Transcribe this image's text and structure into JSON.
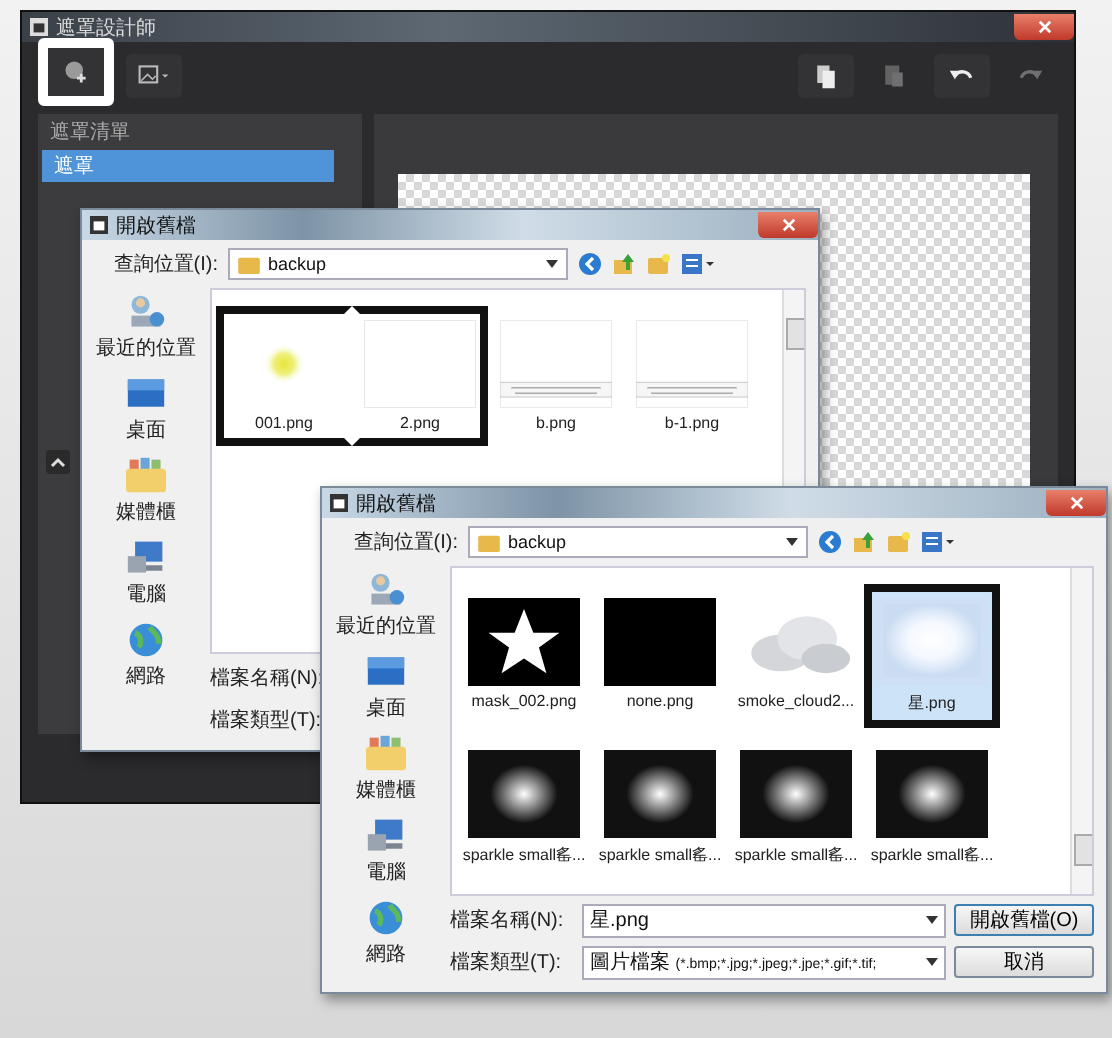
{
  "app": {
    "title": "遮罩設計師",
    "toolbar": [
      {
        "kind": "add",
        "disabled": false,
        "highlighted": true
      },
      {
        "kind": "image-menu",
        "disabled": false,
        "highlighted": false
      },
      {
        "kind": "copy",
        "disabled": false,
        "highlighted": false
      },
      {
        "kind": "paste",
        "disabled": true,
        "highlighted": false
      },
      {
        "kind": "undo",
        "disabled": false,
        "highlighted": false
      },
      {
        "kind": "redo",
        "disabled": true,
        "highlighted": false
      }
    ],
    "panel_header": "遮罩清單",
    "panel_items": [
      {
        "label": "遮罩",
        "selected": true
      }
    ]
  },
  "dialogs": [
    {
      "title": "開啟舊檔",
      "location_label": "查詢位置(I):",
      "folder": "backup",
      "places": [
        {
          "kind": "recent",
          "label": "最近的位置"
        },
        {
          "kind": "desktop",
          "label": "桌面"
        },
        {
          "kind": "library",
          "label": "媒體櫃"
        },
        {
          "kind": "computer",
          "label": "電腦"
        },
        {
          "kind": "network",
          "label": "網路"
        }
      ],
      "files": [
        {
          "name": "001.png",
          "kind": "glow-yellow",
          "selected": false,
          "highlighted": true
        },
        {
          "name": "2.png",
          "kind": "blank",
          "selected": false,
          "highlighted": true
        },
        {
          "name": "b.png",
          "kind": "text-strip",
          "selected": false,
          "highlighted": false
        },
        {
          "name": "b-1.png",
          "kind": "text-strip",
          "selected": false,
          "highlighted": false
        }
      ],
      "filename_label": "檔案名稱(N):",
      "filetype_label": "檔案類型(T):"
    },
    {
      "title": "開啟舊檔",
      "location_label": "查詢位置(I):",
      "folder": "backup",
      "places": [
        {
          "kind": "recent",
          "label": "最近的位置"
        },
        {
          "kind": "desktop",
          "label": "桌面"
        },
        {
          "kind": "library",
          "label": "媒體櫃"
        },
        {
          "kind": "computer",
          "label": "電腦"
        },
        {
          "kind": "network",
          "label": "網路"
        }
      ],
      "files": [
        {
          "name": "mask_002.png",
          "kind": "star",
          "selected": false,
          "highlighted": false
        },
        {
          "name": "none.png",
          "kind": "black",
          "selected": false,
          "highlighted": false
        },
        {
          "name": "smoke_cloud2...",
          "kind": "cloud",
          "selected": false,
          "highlighted": false
        },
        {
          "name": "星.png",
          "kind": "glow-blue",
          "selected": true,
          "highlighted": true
        },
        {
          "name": "sparkle small䍃...",
          "kind": "sparkle",
          "selected": false,
          "highlighted": false
        },
        {
          "name": "sparkle small䍃...",
          "kind": "sparkle",
          "selected": false,
          "highlighted": false
        },
        {
          "name": "sparkle small䍃...",
          "kind": "sparkle",
          "selected": false,
          "highlighted": false
        },
        {
          "name": "sparkle small䍃...",
          "kind": "sparkle",
          "selected": false,
          "highlighted": false
        }
      ],
      "filename_label": "檔案名稱(N):",
      "filetype_label": "檔案類型(T):",
      "filename": "星.png",
      "filetype_name": "圖片檔案",
      "filetype_pattern": "(*.bmp;*.jpg;*.jpeg;*.jpe;*.gif;*.tif;",
      "buttons": [
        "開啟舊檔(O)",
        "取消"
      ]
    }
  ]
}
